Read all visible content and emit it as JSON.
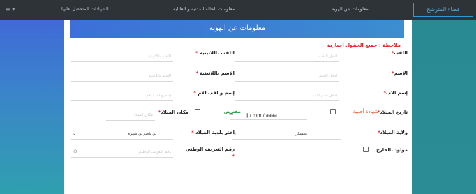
{
  "nav": {
    "menu_icon": "≡ ▾",
    "tab_certificates": "الشهادات المتحصل عليها",
    "tab_civil": "معلومات الحالة المدنية و العائلية",
    "tab_identity": "معلومات عن الهوية",
    "brand": "فضاء المترشح"
  },
  "form": {
    "header": "معلومات عن الهوية",
    "note": "ملاحظة : جميع الحقول اجبارية",
    "last_name_label": "اللقب",
    "last_name_placeholder": "أدخل اللقب",
    "last_name_latin_label": "اللقب باللاتينية",
    "last_name_latin_placeholder": "اللقب باللاتينية",
    "first_name_label": "الإسم",
    "first_name_placeholder": "أدخل الاسم",
    "first_name_latin_label": "الإسم باللاتينية",
    "first_name_latin_placeholder": "الإسم باللاتينية",
    "father_name_label": "إسم الاب",
    "father_name_placeholder": "أدخل اسم الاب",
    "mother_name_label": "إسم و لقب الام",
    "mother_name_placeholder": "إسم و لقب الام",
    "foreign_cert_label": "شهادة أجنبية",
    "birth_date_label": "تاريخ الميلاد",
    "birth_date_value": "jj / mm / aaaa",
    "presumed_label": "مفترض",
    "birth_place_label": "مكان الميلاد",
    "birth_place_placeholder": "مكان الميلاد",
    "birth_wilaya_label": "ولاية الميلاد",
    "birth_wilaya_value": "معسكر",
    "birth_commune_label": "اختر بلدية الميلاد",
    "birth_commune_value": "بن ناصر بن شهرة",
    "born_abroad_label": "مولود بالخارج",
    "nin_label": "رقم التعريف الوطني",
    "nin_placeholder": "رقم التعريف الوطني",
    "required_mark": "*"
  },
  "colors": {
    "accent_blue": "#3d6fd8",
    "required_red": "#e0242b",
    "green": "#1a9a3a",
    "teal_bg": "#2a8a94"
  }
}
